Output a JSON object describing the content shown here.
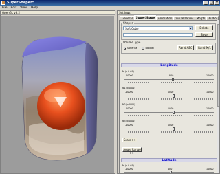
{
  "window": {
    "title": "SuperShaper*"
  },
  "menu": [
    "File",
    "Edit",
    "View",
    "Help"
  ],
  "viewport": {
    "title": "OpenGL v3.2"
  },
  "panel": {
    "title": "Settings",
    "tabs": [
      "General",
      "SuperShape",
      "Animation",
      "Visualization",
      "Morph",
      "Audio"
    ],
    "active_tab": "SuperShape"
  },
  "shapes": {
    "group_label": "Shapes",
    "selected": "Soft Cube",
    "delete_label": "Delete",
    "save_label": "Save"
  },
  "volume": {
    "group_label": "Volume Type",
    "options": [
      "Spherical",
      "Toroidal"
    ],
    "selected": "Spherical",
    "rand_wave_label": "Rand ABC",
    "rand_pos_label": "Rand M/L"
  },
  "longitude": {
    "header": "Longitude",
    "sliders": [
      {
        "label": "M (x 0.01)",
        "min": "-10000",
        "value": "800",
        "max": "10000",
        "fraction": 0.54
      },
      {
        "label": "N1 (x 0.01)",
        "min": "-10000",
        "value": "1000",
        "max": "10000",
        "fraction": 0.55
      },
      {
        "label": "N2 (x 0.01)",
        "min": "-10000",
        "value": "1000",
        "max": "10000",
        "fraction": 0.55
      },
      {
        "label": "N3 (x 0.01)",
        "min": "-10000",
        "value": "1000",
        "max": "10000",
        "fraction": 0.55
      }
    ],
    "scale_label": "Scale >>",
    "angle_range_label": "Angle Range >>"
  },
  "latitude": {
    "header": "Latitude",
    "sliders": [
      {
        "label": "M (x 0.01)",
        "min": "-10000",
        "value": "400",
        "max": "10000",
        "fraction": 0.52
      }
    ]
  }
}
